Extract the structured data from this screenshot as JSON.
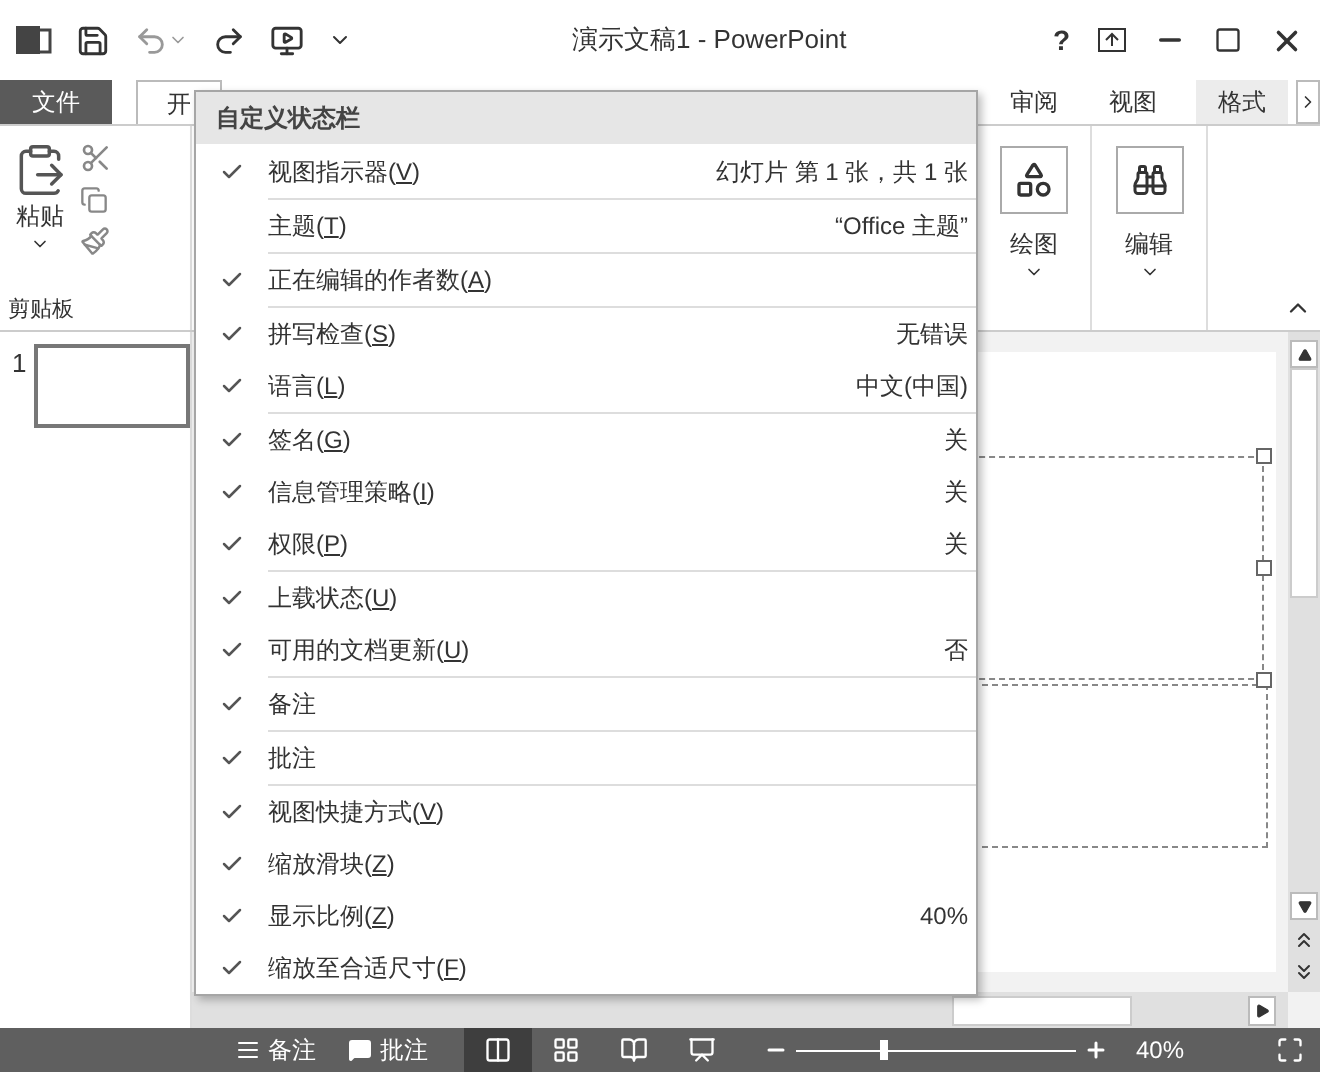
{
  "title_bar": {
    "title": "演示文稿1 - PowerPoint",
    "help": "?"
  },
  "ribbon_tabs": [
    {
      "label": "文件",
      "kind": "file",
      "selected": false
    },
    {
      "label": "开",
      "kind": "tab",
      "selected": true
    },
    {
      "label": "审阅",
      "kind": "tab",
      "selected": false
    },
    {
      "label": "视图",
      "kind": "tab",
      "selected": false
    },
    {
      "label": "格式",
      "kind": "context",
      "selected": false
    }
  ],
  "clipboard": {
    "paste": "粘贴",
    "label": "剪贴板"
  },
  "drawing": {
    "label": "绘图"
  },
  "editing": {
    "label": "编辑"
  },
  "thumbnails": [
    {
      "number": "1"
    }
  ],
  "context_menu": {
    "title": "自定义状态栏",
    "groups": [
      [
        {
          "label": "视图指示器(V)",
          "checked": true,
          "value": "幻灯片 第 1 张，共 1 张"
        }
      ],
      [
        {
          "label": "主题(T)",
          "checked": false,
          "value": "“Office 主题”"
        }
      ],
      [
        {
          "label": "正在编辑的作者数(A)",
          "checked": true
        }
      ],
      [
        {
          "label": "拼写检查(S)",
          "checked": true,
          "value": "无错误"
        },
        {
          "label": "语言(L)",
          "checked": true,
          "value": "中文(中国)"
        }
      ],
      [
        {
          "label": "签名(G)",
          "checked": true,
          "value": "关"
        },
        {
          "label": "信息管理策略(I)",
          "checked": true,
          "value": "关"
        },
        {
          "label": "权限(P)",
          "checked": true,
          "value": "关"
        }
      ],
      [
        {
          "label": "上载状态(U)",
          "checked": true
        },
        {
          "label": "可用的文档更新(U)",
          "checked": true,
          "value": "否"
        }
      ],
      [
        {
          "label": "备注",
          "checked": true
        }
      ],
      [
        {
          "label": "批注",
          "checked": true
        }
      ],
      [
        {
          "label": "视图快捷方式(V)",
          "checked": true
        },
        {
          "label": "缩放滑块(Z)",
          "checked": true
        },
        {
          "label": "显示比例(Z)",
          "checked": true,
          "value": "40%"
        },
        {
          "label": "缩放至合适尺寸(F)",
          "checked": true
        }
      ]
    ]
  },
  "status_bar": {
    "notes": "备注",
    "comments": "批注",
    "views": [
      {
        "kind": "normal",
        "selected": true
      },
      {
        "kind": "sorter",
        "selected": false
      },
      {
        "kind": "reading",
        "selected": false
      },
      {
        "kind": "slideshow",
        "selected": false
      }
    ],
    "zoom": {
      "level": 0.3
    },
    "zoom_text": "40%"
  }
}
